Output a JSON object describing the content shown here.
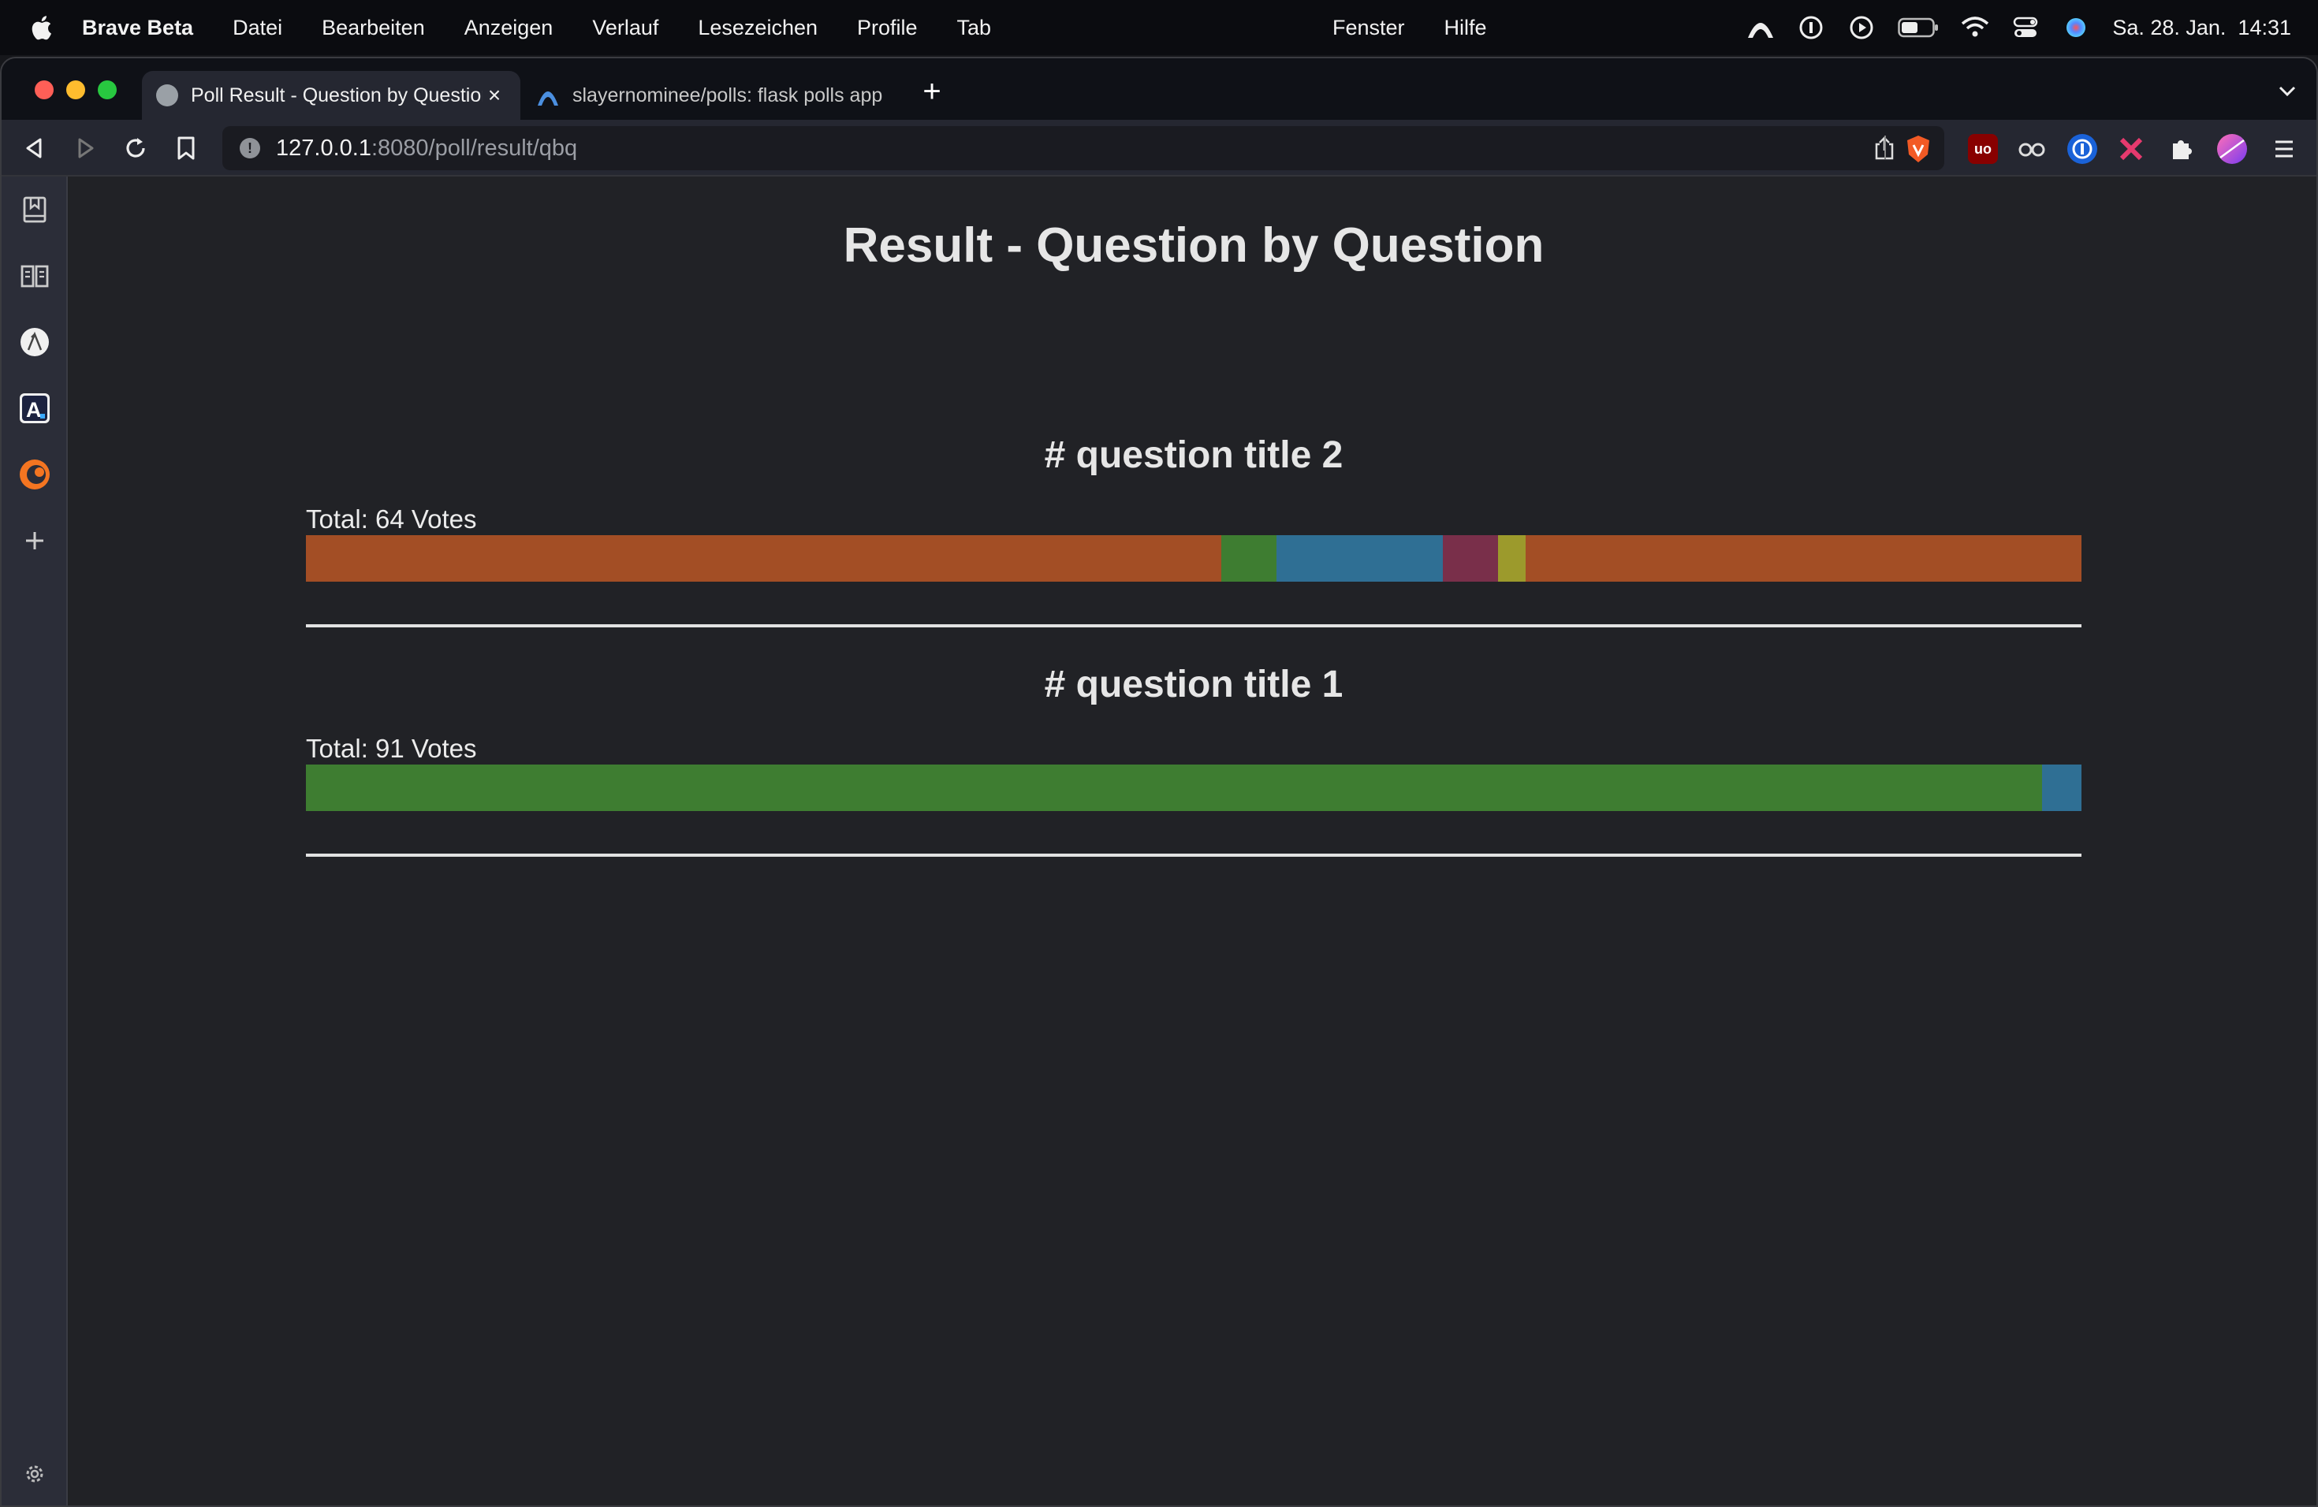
{
  "menubar": {
    "app_name": "Brave Beta",
    "menus": [
      "Datei",
      "Bearbeiten",
      "Anzeigen",
      "Verlauf",
      "Lesezeichen",
      "Profile",
      "Tab"
    ],
    "menus_right": [
      "Fenster",
      "Hilfe"
    ],
    "clock": "Sa. 28. Jan.  14:31"
  },
  "tabs": [
    {
      "title": "Poll Result - Question by Question",
      "active": true,
      "favicon": "globe-icon"
    },
    {
      "title": "slayernominee/polls: flask polls app",
      "active": false,
      "favicon": "arc-icon"
    }
  ],
  "address": {
    "host": "127.0.0.1",
    "rest": ":8080/poll/result/qbq"
  },
  "page": {
    "title": "Result - Question by Question",
    "questions": [
      {
        "title": "# question title 2",
        "total_label": "Total: 64 Votes",
        "segments": [
          {
            "color": "#a34e25",
            "share": 0.5156
          },
          {
            "color": "#3e7d31",
            "share": 0.0313
          },
          {
            "color": "#2f6f94",
            "share": 0.0938
          },
          {
            "color": "#792f4a",
            "share": 0.0313
          },
          {
            "color": "#9c9a2c",
            "share": 0.0156
          },
          {
            "color": "#a34e25",
            "share": 0.3125
          }
        ]
      },
      {
        "title": "# question title 1",
        "total_label": "Total: 91 Votes",
        "segments": [
          {
            "color": "#3e7d31",
            "share": 0.978
          },
          {
            "color": "#2f6f94",
            "share": 0.022
          }
        ]
      }
    ]
  }
}
